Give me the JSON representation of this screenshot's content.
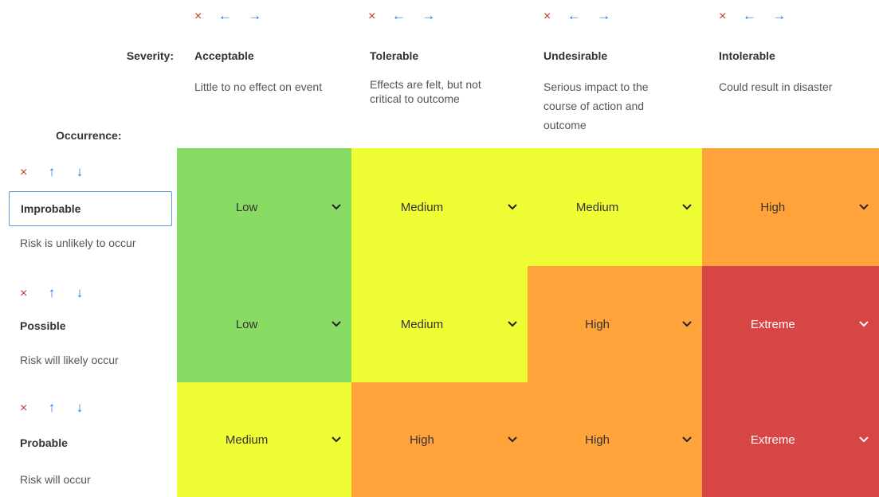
{
  "columns_controls": {
    "delete_icon": "×",
    "left_icon": "←",
    "right_icon": "→"
  },
  "rows_controls": {
    "delete_icon": "×",
    "up_icon": "↑",
    "down_icon": "↓"
  },
  "severity_label": "Severity:",
  "occurrence_label": "Occurrence:",
  "columns": [
    {
      "title": "Acceptable",
      "desc": "Little to no effect on event"
    },
    {
      "title": "Tolerable",
      "desc": "Effects are felt, but not critical to outcome"
    },
    {
      "title": "Undesirable",
      "desc": "Serious impact to the course of action and outcome"
    },
    {
      "title": "Intolerable",
      "desc": "Could result in disaster"
    }
  ],
  "rows": [
    {
      "title": "Improbable",
      "desc": "Risk is unlikely to occur"
    },
    {
      "title": "Possible",
      "desc": "Risk will likely occur"
    },
    {
      "title": "Probable",
      "desc": "Risk will occur"
    }
  ],
  "cells": [
    [
      "Low",
      "Medium",
      "Medium",
      "High"
    ],
    [
      "Low",
      "Medium",
      "High",
      "Extreme"
    ],
    [
      "Medium",
      "High",
      "High",
      "Extreme"
    ]
  ],
  "colors": {
    "Low": "#88dc63",
    "Medium": "#eefd34",
    "High": "#ffa33a",
    "Extreme": "#d84545"
  },
  "chevron_icon": "chevron-down-icon"
}
